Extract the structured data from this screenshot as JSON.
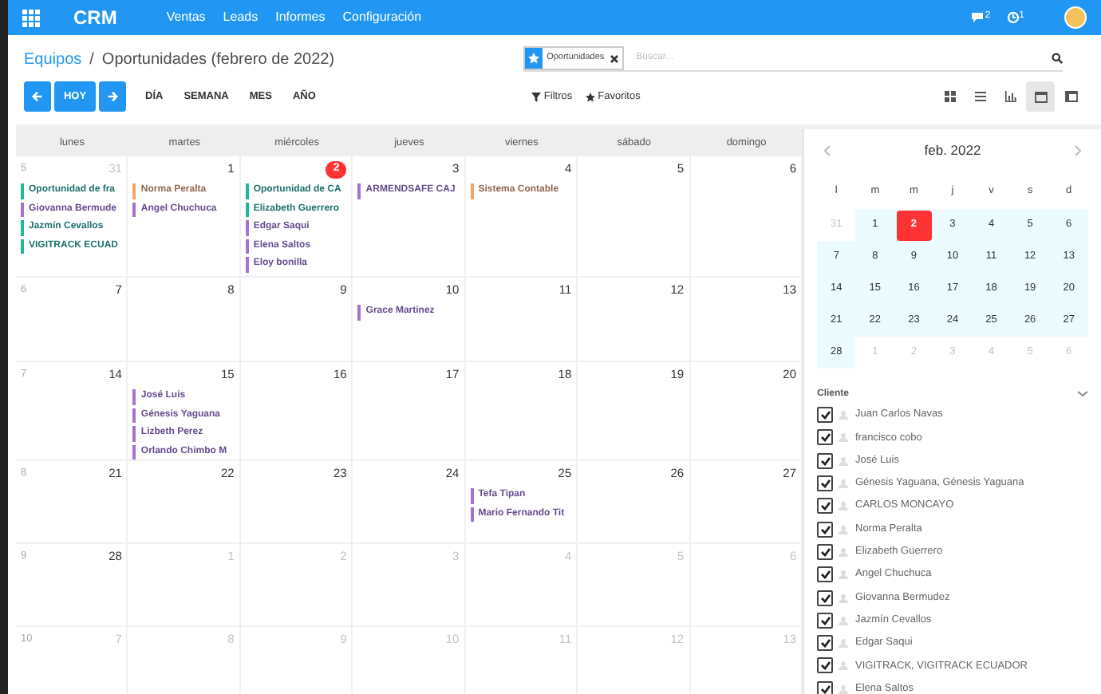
{
  "navbar": {
    "brand": "CRM",
    "menu": [
      "Ventas",
      "Leads",
      "Informes",
      "Configuración"
    ],
    "messages_count": "2",
    "activities_count": "1"
  },
  "breadcrumb": {
    "parent": "Equipos",
    "separator": "/",
    "current": "Oportunidades (febrero de 2022)"
  },
  "search": {
    "facet": "Oportunidades",
    "placeholder": "Buscar..."
  },
  "controls": {
    "today": "HOY",
    "scales": [
      "DÍA",
      "SEMANA",
      "MES",
      "AÑO"
    ],
    "filters": "Filtros",
    "favorites": "Favoritos"
  },
  "views": [
    {
      "kind": "kanban",
      "selected": false
    },
    {
      "kind": "list",
      "selected": false
    },
    {
      "kind": "graph",
      "selected": false
    },
    {
      "kind": "calendar",
      "selected": true
    },
    {
      "kind": "pivot",
      "selected": false
    }
  ],
  "calendar": {
    "weekdays": [
      "lunes",
      "martes",
      "miércoles",
      "jueves",
      "viernes",
      "sábado",
      "domingo"
    ],
    "weeks": [
      {
        "week": "5",
        "days": [
          {
            "day": "31",
            "in_month": false,
            "today": false,
            "events": [
              {
                "title": "Oportunidad de fra",
                "color": "#21b799"
              },
              {
                "title": "Giovanna Bermude",
                "color": "#a374d1"
              },
              {
                "title": "Jazmín Cevallos",
                "color": "#21b799"
              },
              {
                "title": "VIGITRACK ECUAD",
                "color": "#21b799"
              }
            ]
          },
          {
            "day": "1",
            "in_month": true,
            "today": false,
            "events": [
              {
                "title": "Norma Peralta",
                "color": "#f4a460"
              },
              {
                "title": "Angel Chuchuca",
                "color": "#a374d1"
              }
            ]
          },
          {
            "day": "2",
            "in_month": true,
            "today": true,
            "events": [
              {
                "title": "Oportunidad de CA",
                "color": "#21b799"
              },
              {
                "title": "Elizabeth Guerrero",
                "color": "#21b799"
              },
              {
                "title": "Edgar Saqui",
                "color": "#a374d1"
              },
              {
                "title": "Elena Saltos",
                "color": "#a374d1"
              },
              {
                "title": "Eloy bonilla",
                "color": "#a374d1"
              }
            ]
          },
          {
            "day": "3",
            "in_month": true,
            "today": false,
            "events": [
              {
                "title": "ARMENDSAFE CAJ",
                "color": "#a374d1"
              }
            ]
          },
          {
            "day": "4",
            "in_month": true,
            "today": false,
            "events": [
              {
                "title": "Sistema Contable",
                "color": "#f4a460"
              }
            ]
          },
          {
            "day": "5",
            "in_month": true,
            "today": false
          },
          {
            "day": "6",
            "in_month": true,
            "today": false
          }
        ]
      },
      {
        "week": "6",
        "days": [
          {
            "day": "7",
            "in_month": true,
            "today": false
          },
          {
            "day": "8",
            "in_month": true,
            "today": false
          },
          {
            "day": "9",
            "in_month": true,
            "today": false
          },
          {
            "day": "10",
            "in_month": true,
            "today": false,
            "events": [
              {
                "title": "Grace Martinez",
                "color": "#a374d1"
              }
            ]
          },
          {
            "day": "11",
            "in_month": true,
            "today": false
          },
          {
            "day": "12",
            "in_month": true,
            "today": false
          },
          {
            "day": "13",
            "in_month": true,
            "today": false
          }
        ]
      },
      {
        "week": "7",
        "days": [
          {
            "day": "14",
            "in_month": true,
            "today": false
          },
          {
            "day": "15",
            "in_month": true,
            "today": false,
            "events": [
              {
                "title": "José Luis",
                "color": "#a374d1"
              },
              {
                "title": "Génesis Yaguana",
                "color": "#a374d1"
              },
              {
                "title": "Lizbeth Perez",
                "color": "#a374d1"
              },
              {
                "title": "Orlando Chimbo M",
                "color": "#a374d1"
              }
            ]
          },
          {
            "day": "16",
            "in_month": true,
            "today": false
          },
          {
            "day": "17",
            "in_month": true,
            "today": false
          },
          {
            "day": "18",
            "in_month": true,
            "today": false
          },
          {
            "day": "19",
            "in_month": true,
            "today": false
          },
          {
            "day": "20",
            "in_month": true,
            "today": false
          }
        ]
      },
      {
        "week": "8",
        "days": [
          {
            "day": "21",
            "in_month": true,
            "today": false
          },
          {
            "day": "22",
            "in_month": true,
            "today": false
          },
          {
            "day": "23",
            "in_month": true,
            "today": false
          },
          {
            "day": "24",
            "in_month": true,
            "today": false
          },
          {
            "day": "25",
            "in_month": true,
            "today": false,
            "events": [
              {
                "title": "Tefa Tipan",
                "color": "#a374d1"
              },
              {
                "title": "Mario Fernando Tit",
                "color": "#a374d1"
              }
            ]
          },
          {
            "day": "26",
            "in_month": true,
            "today": false
          },
          {
            "day": "27",
            "in_month": true,
            "today": false
          }
        ]
      },
      {
        "week": "9",
        "days": [
          {
            "day": "28",
            "in_month": true,
            "today": false
          },
          {
            "day": "1",
            "in_month": false,
            "today": false
          },
          {
            "day": "2",
            "in_month": false,
            "today": false
          },
          {
            "day": "3",
            "in_month": false,
            "today": false
          },
          {
            "day": "4",
            "in_month": false,
            "today": false
          },
          {
            "day": "5",
            "in_month": false,
            "today": false
          },
          {
            "day": "6",
            "in_month": false,
            "today": false
          }
        ]
      },
      {
        "week": "10",
        "days": [
          {
            "day": "7",
            "in_month": false,
            "today": false
          },
          {
            "day": "8",
            "in_month": false,
            "today": false
          },
          {
            "day": "9",
            "in_month": false,
            "today": false
          },
          {
            "day": "10",
            "in_month": false,
            "today": false
          },
          {
            "day": "11",
            "in_month": false,
            "today": false
          },
          {
            "day": "12",
            "in_month": false,
            "today": false
          },
          {
            "day": "13",
            "in_month": false,
            "today": false
          }
        ]
      }
    ]
  },
  "mini_calendar": {
    "title": "feb. 2022",
    "weekdays": [
      "l",
      "m",
      "m",
      "j",
      "v",
      "s",
      "d"
    ],
    "days": [
      {
        "day": "31",
        "in_month": false,
        "selected": false
      },
      {
        "day": "1",
        "in_month": true,
        "selected": false
      },
      {
        "day": "2",
        "in_month": true,
        "selected": true
      },
      {
        "day": "3",
        "in_month": true,
        "selected": false
      },
      {
        "day": "4",
        "in_month": true,
        "selected": false
      },
      {
        "day": "5",
        "in_month": true,
        "selected": false
      },
      {
        "day": "6",
        "in_month": true,
        "selected": false
      },
      {
        "day": "7",
        "in_month": true,
        "selected": false
      },
      {
        "day": "8",
        "in_month": true,
        "selected": false
      },
      {
        "day": "9",
        "in_month": true,
        "selected": false
      },
      {
        "day": "10",
        "in_month": true,
        "selected": false
      },
      {
        "day": "11",
        "in_month": true,
        "selected": false
      },
      {
        "day": "12",
        "in_month": true,
        "selected": false
      },
      {
        "day": "13",
        "in_month": true,
        "selected": false
      },
      {
        "day": "14",
        "in_month": true,
        "selected": false
      },
      {
        "day": "15",
        "in_month": true,
        "selected": false
      },
      {
        "day": "16",
        "in_month": true,
        "selected": false
      },
      {
        "day": "17",
        "in_month": true,
        "selected": false
      },
      {
        "day": "18",
        "in_month": true,
        "selected": false
      },
      {
        "day": "19",
        "in_month": true,
        "selected": false
      },
      {
        "day": "20",
        "in_month": true,
        "selected": false
      },
      {
        "day": "21",
        "in_month": true,
        "selected": false
      },
      {
        "day": "22",
        "in_month": true,
        "selected": false
      },
      {
        "day": "23",
        "in_month": true,
        "selected": false
      },
      {
        "day": "24",
        "in_month": true,
        "selected": false
      },
      {
        "day": "25",
        "in_month": true,
        "selected": false
      },
      {
        "day": "26",
        "in_month": true,
        "selected": false
      },
      {
        "day": "27",
        "in_month": true,
        "selected": false
      },
      {
        "day": "28",
        "in_month": true,
        "selected": false
      },
      {
        "day": "1",
        "in_month": false,
        "selected": false
      },
      {
        "day": "2",
        "in_month": false,
        "selected": false
      },
      {
        "day": "3",
        "in_month": false,
        "selected": false
      },
      {
        "day": "4",
        "in_month": false,
        "selected": false
      },
      {
        "day": "5",
        "in_month": false,
        "selected": false
      },
      {
        "day": "6",
        "in_month": false,
        "selected": false
      }
    ]
  },
  "filter": {
    "title": "Cliente",
    "items": [
      {
        "label": "Juan Carlos Navas",
        "checked": true
      },
      {
        "label": "francisco cobo",
        "checked": true
      },
      {
        "label": "José Luis",
        "checked": true
      },
      {
        "label": "Génesis Yaguana, Génesis Yaguana",
        "checked": true
      },
      {
        "label": "CARLOS MONCAYO",
        "checked": true
      },
      {
        "label": "Norma Peralta",
        "checked": true
      },
      {
        "label": "Elizabeth Guerrero",
        "checked": true
      },
      {
        "label": "Angel Chuchuca",
        "checked": true
      },
      {
        "label": "Giovanna Bermudez",
        "checked": true
      },
      {
        "label": "Jazmín Cevallos",
        "checked": true
      },
      {
        "label": "Edgar Saqui",
        "checked": true
      },
      {
        "label": "VIGITRACK, VIGITRACK ECUADOR",
        "checked": true
      },
      {
        "label": "Elena Saltos",
        "checked": true
      }
    ]
  }
}
